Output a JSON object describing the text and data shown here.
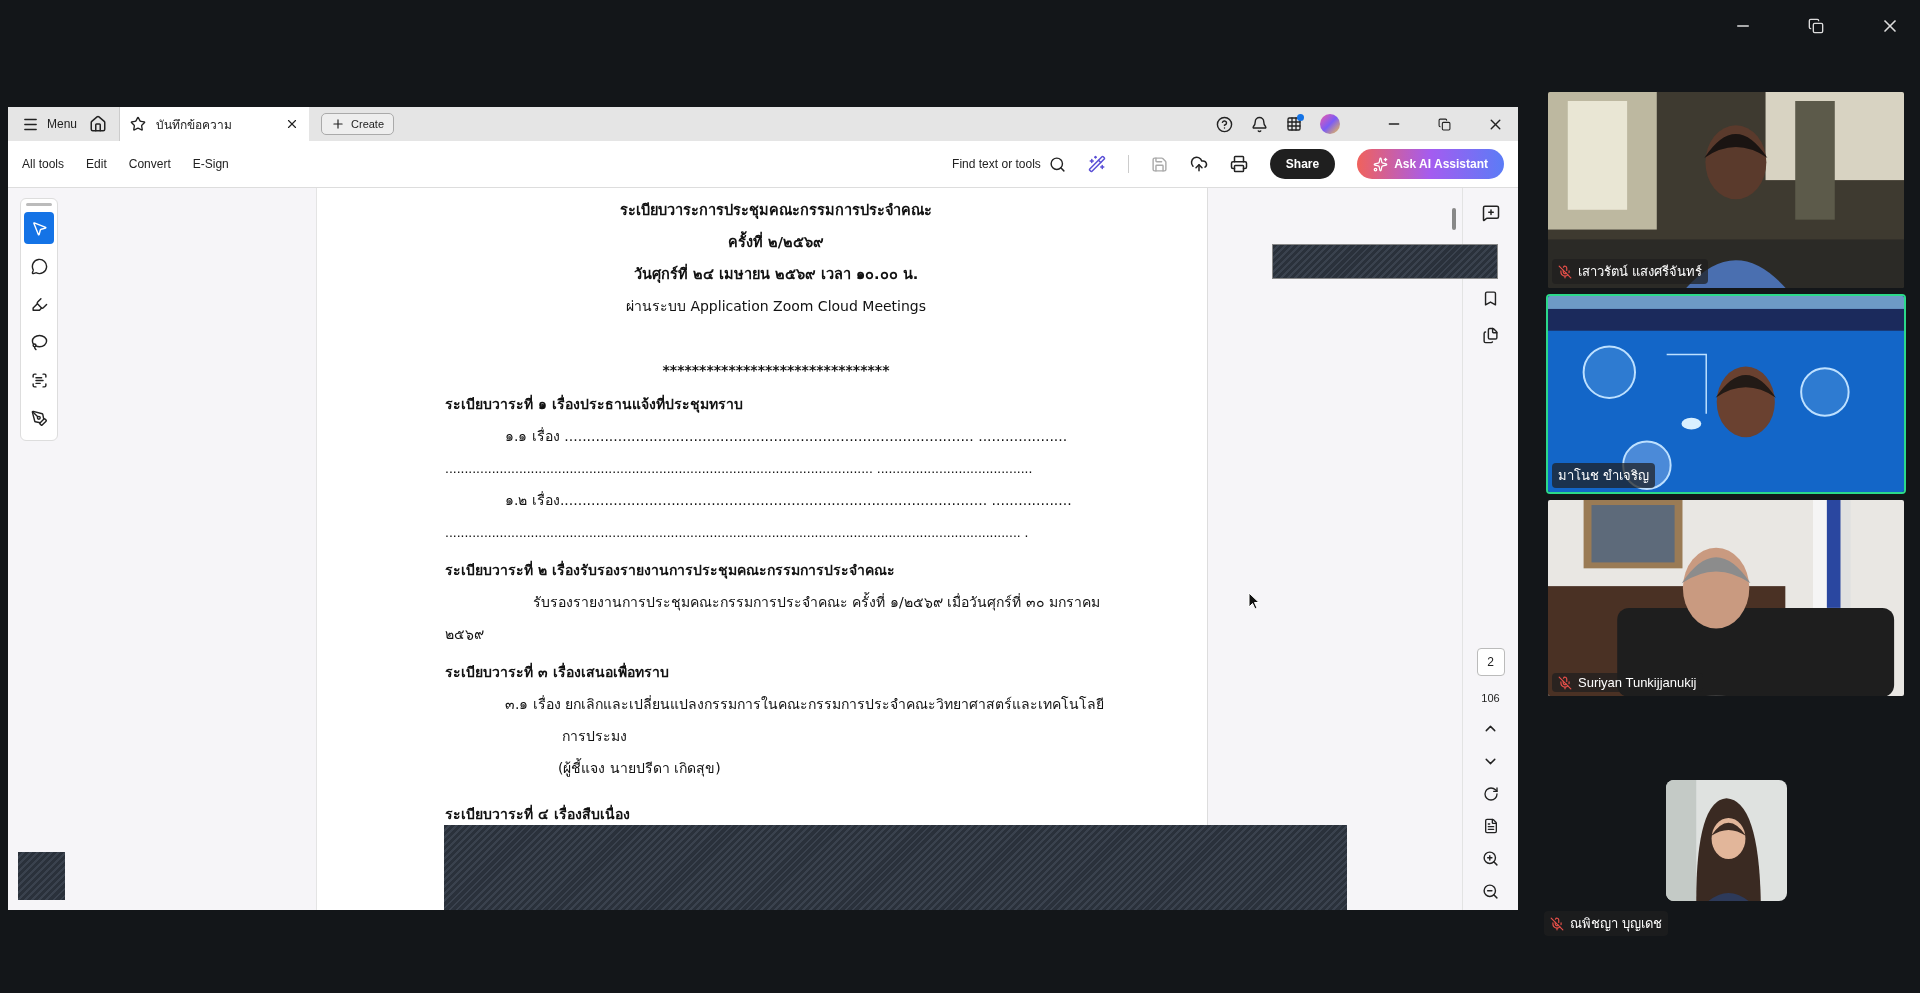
{
  "acrobat": {
    "menu_label": "Menu",
    "tabs": [
      {
        "label": "บันทึกข้อความ",
        "selected": true
      }
    ],
    "create_button": "Create",
    "toolbar_menu": [
      "All tools",
      "Edit",
      "Convert",
      "E-Sign"
    ],
    "find_placeholder": "Find text or tools",
    "share_button": "Share",
    "ai_button": "Ask AI Assistant",
    "tools": [
      {
        "kind": "select",
        "selected": true
      },
      {
        "kind": "comment",
        "selected": false
      },
      {
        "kind": "highlight",
        "selected": false
      },
      {
        "kind": "draw",
        "selected": false
      },
      {
        "kind": "text",
        "selected": false
      },
      {
        "kind": "sign",
        "selected": false
      }
    ],
    "document": {
      "title_lines": [
        "ระเบียบวาระการประชุมคณะกรรมการประจำคณะ",
        "ครั้งที่ ๒/๒๕๖๙",
        "วันศุกร์ที่ ๒๔ เมษายน ๒๕๖๙ เวลา ๑๐.๐๐ น.",
        "ผ่านระบบ Application Zoom Cloud Meetings"
      ],
      "separator": "*******************************",
      "blocks": [
        {
          "kind": "heading",
          "text": "ระเบียบวาระที่ ๑ เรื่องประธานแจ้งที่ประชุมทราบ"
        },
        {
          "kind": "item",
          "text": "๑.๑ เรื่อง ............................................................................................ ...................."
        },
        {
          "kind": "dots",
          "text": ".............................................................................................................. ........................................"
        },
        {
          "kind": "item",
          "text": "๑.๒ เรื่อง................................................................................................ .................."
        },
        {
          "kind": "dots",
          "text": ".................................................................................................................................................... ."
        },
        {
          "kind": "heading",
          "text": "ระเบียบวาระที่ ๒ เรื่องรับรองรายงานการประชุมคณะกรรมการประจำคณะ"
        },
        {
          "kind": "paragraph",
          "text": "รับรองรายงานการประชุมคณะกรรมการประจำคณะ ครั้งที่ ๑/๒๕๖๙  เมื่อวันศุกร์ที่ ๓๐ มกราคม ๒๕๖๙"
        },
        {
          "kind": "heading",
          "text": "ระเบียบวาระที่ ๓ เรื่องเสนอเพื่อทราบ"
        },
        {
          "kind": "item",
          "text": "๓.๑ เรื่อง ยกเลิกและเปลี่ยนแปลงกรรมการในคณะกรรมการประจำคณะวิทยาศาสตร์และเทคโนโลยีการประมง"
        },
        {
          "kind": "note",
          "text": "(ผู้ชี้แจง นายปรีดา  เกิดสุข)"
        },
        {
          "kind": "heading",
          "text": "ระเบียบวาระที่ ๔ เรื่องสืบเนื่อง"
        }
      ]
    },
    "page_number": "2",
    "page_count": "106"
  },
  "participants": [
    {
      "name": "เสาวรัตน์  แสงศรีจันทร์",
      "muted": true,
      "speaking": false,
      "kind": "video"
    },
    {
      "name": "มาโนช ขำเจริญ",
      "muted": false,
      "speaking": true,
      "kind": "video"
    },
    {
      "name": "Suriyan Tunkijjanukij",
      "muted": true,
      "speaking": false,
      "kind": "video"
    },
    {
      "name": "ณพิชญา บุญเดช",
      "muted": true,
      "speaking": false,
      "kind": "avatar"
    }
  ]
}
